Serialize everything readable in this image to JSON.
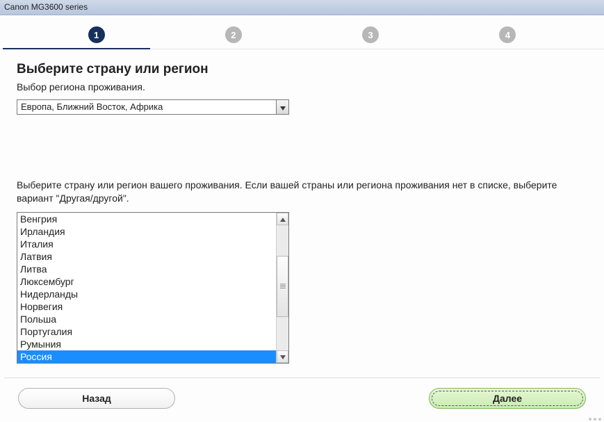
{
  "window": {
    "title": "Canon MG3600 series"
  },
  "stepper": {
    "steps": [
      "1",
      "2",
      "3",
      "4"
    ],
    "active_index": 0
  },
  "page": {
    "heading": "Выберите страну или регион",
    "subheading": "Выбор региона проживания.",
    "region_combo": {
      "selected": "Европа, Ближний Восток, Африка"
    },
    "instruction": "Выберите страну или регион вашего проживания. Если вашей страны или региона проживания нет в списке, выберите вариант \"Другая/другой\".",
    "country_list": {
      "visible_items": [
        "Венгрия",
        "Ирландия",
        "Италия",
        "Латвия",
        "Литва",
        "Люксембург",
        "Нидерланды",
        "Норвегия",
        "Польша",
        "Португалия",
        "Румыния",
        "Россия"
      ],
      "selected_index": 11
    }
  },
  "footer": {
    "back_label": "Назад",
    "next_label": "Далее"
  }
}
